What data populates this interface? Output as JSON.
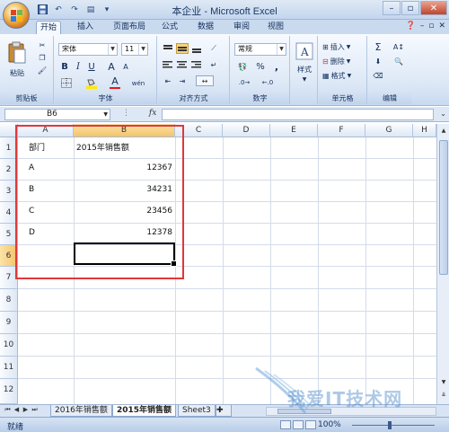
{
  "window": {
    "title": "本企业 - Microsoft Excel"
  },
  "tabs": [
    "开始",
    "插入",
    "页面布局",
    "公式",
    "数据",
    "审阅",
    "视图"
  ],
  "ribbon": {
    "clipboard": {
      "paste_label": "粘贴",
      "group_label": "剪贴板"
    },
    "font": {
      "font_name": "宋体",
      "font_size": "11",
      "bold": "B",
      "italic": "I",
      "underline": "U",
      "grow": "A",
      "shrink": "A",
      "font_color": "A",
      "phonetic": "wén",
      "group_label": "字体"
    },
    "alignment": {
      "group_label": "对齐方式"
    },
    "number": {
      "format": "常规",
      "percent": "%",
      "comma": ",",
      "group_label": "数字"
    },
    "styles": {
      "label": "样式"
    },
    "cells": {
      "insert": "插入",
      "delete": "删除",
      "format": "格式",
      "group_label": "单元格"
    },
    "editing": {
      "sum": "Σ",
      "group_label": "编辑"
    }
  },
  "formula_bar": {
    "name_box": "B6",
    "fx": "fx",
    "value": ""
  },
  "columns": [
    "A",
    "B",
    "C",
    "D",
    "E",
    "F",
    "G",
    "H"
  ],
  "rows": [
    "1",
    "2",
    "3",
    "4",
    "5",
    "6",
    "7",
    "8",
    "9",
    "10",
    "11",
    "12"
  ],
  "cells": {
    "A1": "部门",
    "B1": "2015年销售额",
    "A2": "A",
    "B2": "12367",
    "A3": "B",
    "B3": "34231",
    "A4": "C",
    "B4": "23456",
    "A5": "D",
    "B5": "12378"
  },
  "sheets": [
    "2016年销售额",
    "2015年销售额",
    "Sheet3"
  ],
  "active_sheet": "2015年销售额",
  "status": {
    "ready": "就绪",
    "zoom": "100%"
  },
  "watermark": "我爱IT技术网",
  "colors": {
    "highlight_box": "#e0383a",
    "selected_header": "#f4c36a",
    "ribbon_bg": "#dde8f6"
  }
}
